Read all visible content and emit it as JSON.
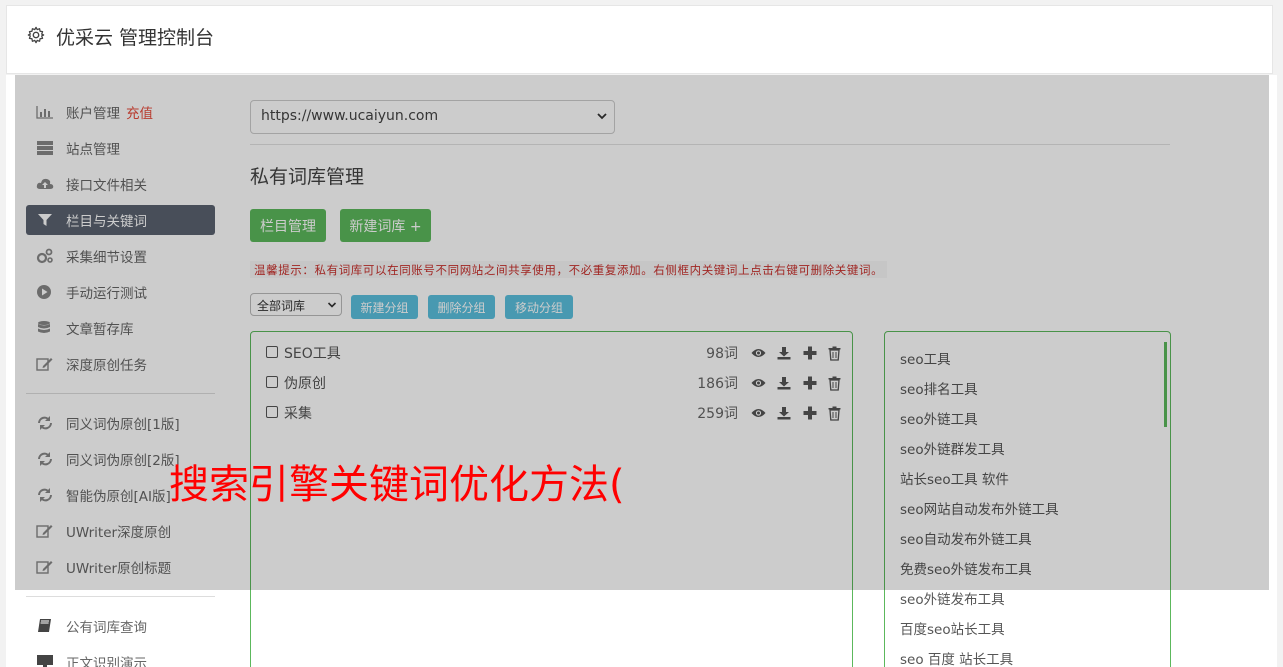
{
  "header": {
    "title": "优采云 管理控制台"
  },
  "sidebar": {
    "group1": [
      {
        "label": "账户管理",
        "badge": "充值",
        "icon": "bar-chart-icon"
      },
      {
        "label": "站点管理",
        "icon": "server-icon"
      },
      {
        "label": "接口文件相关",
        "icon": "cloud-upload-icon"
      },
      {
        "label": "栏目与关键词",
        "icon": "filter-icon",
        "active": true
      },
      {
        "label": "采集细节设置",
        "icon": "cogs-icon"
      },
      {
        "label": "手动运行测试",
        "icon": "play-circle-icon"
      },
      {
        "label": "文章暂存库",
        "icon": "database-icon"
      },
      {
        "label": "深度原创任务",
        "icon": "edit-icon"
      }
    ],
    "group2": [
      {
        "label": "同义词伪原创[1版]",
        "icon": "refresh-icon"
      },
      {
        "label": "同义词伪原创[2版]",
        "icon": "refresh-icon"
      },
      {
        "label": "智能伪原创[AI版]",
        "icon": "refresh-icon"
      },
      {
        "label": "UWriter深度原创",
        "icon": "edit-icon"
      },
      {
        "label": "UWriter原创标题",
        "icon": "edit-icon"
      }
    ],
    "group3": [
      {
        "label": "公有词库查询",
        "icon": "book-icon"
      },
      {
        "label": "正文识别演示",
        "icon": "monitor-icon"
      }
    ]
  },
  "main": {
    "site_select": "https://www.ucaiyun.com",
    "page_title": "私有词库管理",
    "btn_columns": "栏目管理",
    "btn_new_lib": "新建词库 +",
    "tip": "温馨提示：私有词库可以在同账号不同网站之间共享使用，不必重复添加。右侧框内关键词上点击右键可删除关键词。",
    "filter_select": "全部词库",
    "btn_new_group": "新建分组",
    "btn_delete_group": "删除分组",
    "btn_move_group": "移动分组",
    "libraries": [
      {
        "name": "SEO工具",
        "count": "98词"
      },
      {
        "name": "伪原创",
        "count": "186词"
      },
      {
        "name": "采集",
        "count": "259词"
      }
    ],
    "keywords": [
      "seo工具",
      "seo排名工具",
      "seo外链工具",
      "seo外链群发工具",
      "站长seo工具 软件",
      "seo网站自动发布外链工具",
      "seo自动发布外链工具",
      "免费seo外链发布工具",
      "seo外链发布工具",
      "百度seo站长工具",
      "seo 百度 站长工具"
    ]
  },
  "overlay": {
    "text": "搜索引擎关键词优化方法("
  },
  "colors": {
    "accent_green": "#5cb85c",
    "accent_blue": "#5bc0de",
    "active_nav": "#5a6270",
    "warning_red": "#c9302c",
    "overlay_text": "#ff0000"
  }
}
